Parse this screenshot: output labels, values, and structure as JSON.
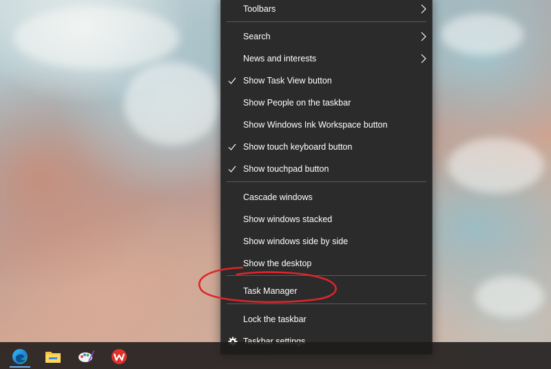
{
  "context_menu": {
    "items": [
      {
        "label": "Toolbars",
        "submenu": true,
        "checked": false
      },
      {
        "label": "Search",
        "submenu": true,
        "checked": false
      },
      {
        "label": "News and interests",
        "submenu": true,
        "checked": false
      },
      {
        "label": "Show Task View button",
        "submenu": false,
        "checked": true
      },
      {
        "label": "Show People on the taskbar",
        "submenu": false,
        "checked": false
      },
      {
        "label": "Show Windows Ink Workspace button",
        "submenu": false,
        "checked": false
      },
      {
        "label": "Show touch keyboard button",
        "submenu": false,
        "checked": true
      },
      {
        "label": "Show touchpad button",
        "submenu": false,
        "checked": true
      },
      {
        "label": "Cascade windows",
        "submenu": false,
        "checked": false
      },
      {
        "label": "Show windows stacked",
        "submenu": false,
        "checked": false
      },
      {
        "label": "Show windows side by side",
        "submenu": false,
        "checked": false
      },
      {
        "label": "Show the desktop",
        "submenu": false,
        "checked": false
      },
      {
        "label": "Task Manager",
        "submenu": false,
        "checked": false,
        "highlighted_by_annotation": true
      },
      {
        "label": "Lock the taskbar",
        "submenu": false,
        "checked": false
      },
      {
        "label": "Taskbar settings",
        "submenu": false,
        "checked": false,
        "icon": "gear-icon"
      }
    ]
  },
  "taskbar": {
    "icons": [
      {
        "name": "edge-icon",
        "active": true
      },
      {
        "name": "file-explorer-icon",
        "active": false
      },
      {
        "name": "paint-icon",
        "active": false
      },
      {
        "name": "wps-office-icon",
        "active": false
      }
    ]
  },
  "colors": {
    "menu_background": "#2b2b2b",
    "menu_text": "#ffffff",
    "separator": "#5a5a5a",
    "annotation": "#e0242b",
    "taskbar": "#1e1a1a"
  }
}
